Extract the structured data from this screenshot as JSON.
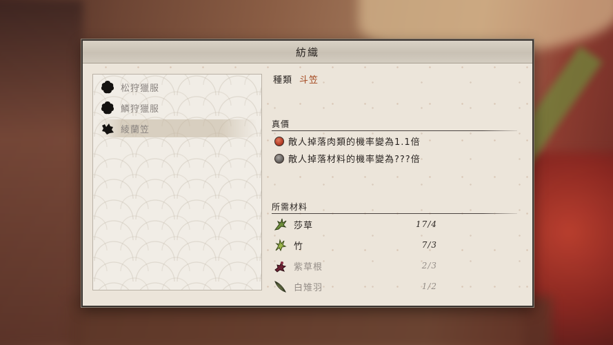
{
  "window": {
    "title": "紡織"
  },
  "recipe_list": {
    "items": [
      {
        "label": "松狩獵服",
        "icon": "unknown-silhouette-icon"
      },
      {
        "label": "鱗狩獵服",
        "icon": "unknown-silhouette-icon"
      },
      {
        "label": "綾蘭笠",
        "icon": "hat-silhouette-icon",
        "selected": true
      }
    ]
  },
  "detail": {
    "kind_label": "種類",
    "kind_value": "斗笠",
    "effects_heading": "真價",
    "effects": [
      {
        "text": "敵人掉落肉類的機率變為1.1倍",
        "icon": "red-orb-icon",
        "color": "#b8412a"
      },
      {
        "text": "敵人掉落材料的機率變為???倍",
        "icon": "gray-orb-icon",
        "color": "#6d6966"
      }
    ],
    "materials_heading": "所需材料",
    "materials": [
      {
        "name": "莎草",
        "count": "17/4",
        "icon": "sedge-icon",
        "available": true
      },
      {
        "name": "竹",
        "count": "7/3",
        "icon": "bamboo-icon",
        "available": true
      },
      {
        "name": "紫草根",
        "count": "2/3",
        "icon": "gromwell-root-icon",
        "available": false
      },
      {
        "name": "白雉羽",
        "count": "1/2",
        "icon": "pheasant-feather-icon",
        "available": false
      }
    ]
  },
  "colors": {
    "panel": "#ece5da",
    "accent_value": "#a3471e",
    "text": "#2a2522",
    "muted": "#958e88"
  }
}
